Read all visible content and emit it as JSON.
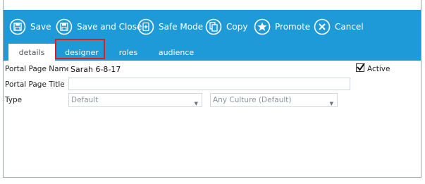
{
  "toolbar": {
    "save": "Save",
    "save_and_close": "Save and Close",
    "safe_mode": "Safe Mode",
    "copy": "Copy",
    "promote": "Promote",
    "cancel": "Cancel",
    "background": "#1f9ad8"
  },
  "tabs": [
    {
      "label": "details",
      "active": true
    },
    {
      "label": "designer",
      "active": false,
      "highlighted": true
    },
    {
      "label": "roles",
      "active": false
    },
    {
      "label": "audience",
      "active": false
    }
  ],
  "form": {
    "portal_page_name_label": "Portal Page Name",
    "portal_page_name_value": "Sarah 6-8-17",
    "portal_page_title_label": "Portal Page Title",
    "portal_page_title_value": "",
    "type_label": "Type",
    "type_value": "Default",
    "culture_value": "Any Culture (Default)",
    "active_label": "Active",
    "active_checked": true
  },
  "highlight_color": "#e01d1d"
}
